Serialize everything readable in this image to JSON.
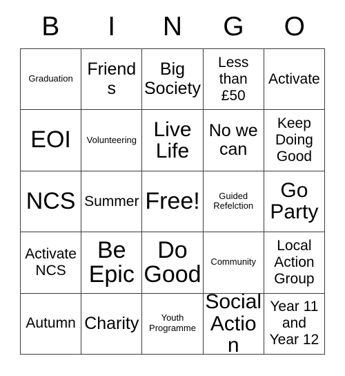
{
  "card": {
    "title": "BINGO",
    "header_letters": [
      "B",
      "I",
      "N",
      "G",
      "O"
    ],
    "columns": 5,
    "rows": 5,
    "border_color": "#3a3a3a",
    "background_color": "#ffffff",
    "text_color": "#000000"
  },
  "cells": [
    {
      "row": 1,
      "col": 1,
      "letter": "B",
      "text": "Graduation",
      "size": "sz-xs"
    },
    {
      "row": 1,
      "col": 2,
      "letter": "I",
      "text": "Friends",
      "size": "sz-l"
    },
    {
      "row": 1,
      "col": 3,
      "letter": "N",
      "text": "Big\nSociety",
      "size": "sz-l"
    },
    {
      "row": 1,
      "col": 4,
      "letter": "G",
      "text": "Less\nthan\n£50",
      "size": "sz-m"
    },
    {
      "row": 1,
      "col": 5,
      "letter": "O",
      "text": "Activate",
      "size": "sz-m"
    },
    {
      "row": 2,
      "col": 1,
      "letter": "B",
      "text": "EOI",
      "size": "sz-xxl"
    },
    {
      "row": 2,
      "col": 2,
      "letter": "I",
      "text": "Volunteering",
      "size": "sz-xs"
    },
    {
      "row": 2,
      "col": 3,
      "letter": "N",
      "text": "Live\nLife",
      "size": "sz-xl"
    },
    {
      "row": 2,
      "col": 4,
      "letter": "G",
      "text": "No we\ncan",
      "size": "sz-l"
    },
    {
      "row": 2,
      "col": 5,
      "letter": "O",
      "text": "Keep\nDoing\nGood",
      "size": "sz-m"
    },
    {
      "row": 3,
      "col": 1,
      "letter": "B",
      "text": "NCS",
      "size": "sz-xxl"
    },
    {
      "row": 3,
      "col": 2,
      "letter": "I",
      "text": "Summer",
      "size": "sz-m"
    },
    {
      "row": 3,
      "col": 3,
      "letter": "N",
      "text": "Free!",
      "size": "sz-xxl"
    },
    {
      "row": 3,
      "col": 4,
      "letter": "G",
      "text": "Guided\nRefelction",
      "size": "sz-xs"
    },
    {
      "row": 3,
      "col": 5,
      "letter": "O",
      "text": "Go\nParty",
      "size": "sz-xl"
    },
    {
      "row": 4,
      "col": 1,
      "letter": "B",
      "text": "Activate\nNCS",
      "size": "sz-m"
    },
    {
      "row": 4,
      "col": 2,
      "letter": "I",
      "text": "Be\nEpic",
      "size": "sz-xxl"
    },
    {
      "row": 4,
      "col": 3,
      "letter": "N",
      "text": "Do\nGood",
      "size": "sz-xxl"
    },
    {
      "row": 4,
      "col": 4,
      "letter": "G",
      "text": "Community",
      "size": "sz-xs"
    },
    {
      "row": 4,
      "col": 5,
      "letter": "O",
      "text": "Local\nAction\nGroup",
      "size": "sz-m"
    },
    {
      "row": 5,
      "col": 1,
      "letter": "B",
      "text": "Autumn",
      "size": "sz-m"
    },
    {
      "row": 5,
      "col": 2,
      "letter": "I",
      "text": "Charity",
      "size": "sz-l"
    },
    {
      "row": 5,
      "col": 3,
      "letter": "N",
      "text": "Youth\nProgramme",
      "size": "sz-xs"
    },
    {
      "row": 5,
      "col": 4,
      "letter": "G",
      "text": "Social\nAction",
      "size": "sz-xl"
    },
    {
      "row": 5,
      "col": 5,
      "letter": "O",
      "text": "Year 11\nand\nYear 12",
      "size": "sz-m"
    }
  ]
}
